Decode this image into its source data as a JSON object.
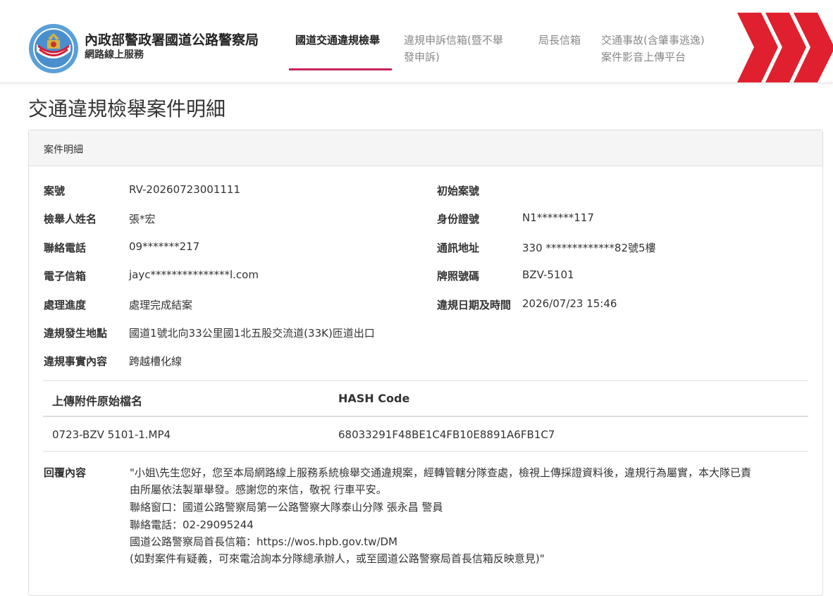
{
  "header": {
    "agency_name": "內政部警政署國道公路警察局",
    "agency_sub": "網路線上服務",
    "brand_color": "#c8235a",
    "nav": [
      {
        "label": "國道交通違規檢舉",
        "active": true
      },
      {
        "label_lines": [
          "違規申訴信箱(暨不舉",
          "發申訴)"
        ]
      },
      {
        "label": "局長信箱"
      },
      {
        "label_lines": [
          "交通事故(含肇事逃逸)",
          "案件影音上傳平台"
        ]
      }
    ]
  },
  "page_title": "交通違規檢舉案件明細",
  "panel": {
    "heading": "案件明細",
    "fields": {
      "case_no": {
        "label": "案號",
        "value": "RV-20260723001111"
      },
      "original_case_no": {
        "label": "初始案號",
        "value": ""
      },
      "reporter_name": {
        "label": "檢舉人姓名",
        "value": "張*宏"
      },
      "id_no": {
        "label": "身份證號",
        "value": "N1*******117"
      },
      "phone": {
        "label": "聯絡電話",
        "value": "09*******217"
      },
      "address": {
        "label": "通訊地址",
        "value": "330 *************82號5樓"
      },
      "email": {
        "label": "電子信箱",
        "value": "jayc***************l.com"
      },
      "plate": {
        "label": "牌照號碼",
        "value": "BZV-5101"
      },
      "progress": {
        "label": "處理進度",
        "value": "處理完成結案"
      },
      "violation_datetime": {
        "label": "違規日期及時間",
        "value": "2026/07/23 15:46"
      },
      "location": {
        "label": "違規發生地點",
        "value": "國道1號北向33公里國1北五股交流道(33K)匝道出口"
      },
      "facts": {
        "label": "違規事實內容",
        "value": "跨越槽化線"
      }
    },
    "attachments": {
      "headers": [
        "上傳附件原始檔名",
        "HASH Code"
      ],
      "rows": [
        {
          "filename": "0723-BZV 5101-1.MP4",
          "hash": "68033291F48BE1C4FB10E8891A6FB1C7"
        }
      ]
    },
    "reply": {
      "label": "回覆內容",
      "lines": [
        "\"小姐\\先生您好，您至本局網路線上服務系統檢舉交通違規案，經轉管轄分隊查處，檢視上傳採證資料後，違規行為屬實，本大隊已責",
        "由所屬依法製單舉發。感謝您的來信，敬祝 行車平安。",
        "聯絡窗口：國道公路警察局第一公路警察大隊泰山分隊 張永昌 警員",
        "聯絡電話：02-29095244",
        "國道公路警察局首長信箱：https://wos.hpb.gov.tw/DM",
        "(如對案件有疑義，可來電洽詢本分隊總承辦人，或至國道公路警察局首長信箱反映意見)\""
      ]
    }
  }
}
